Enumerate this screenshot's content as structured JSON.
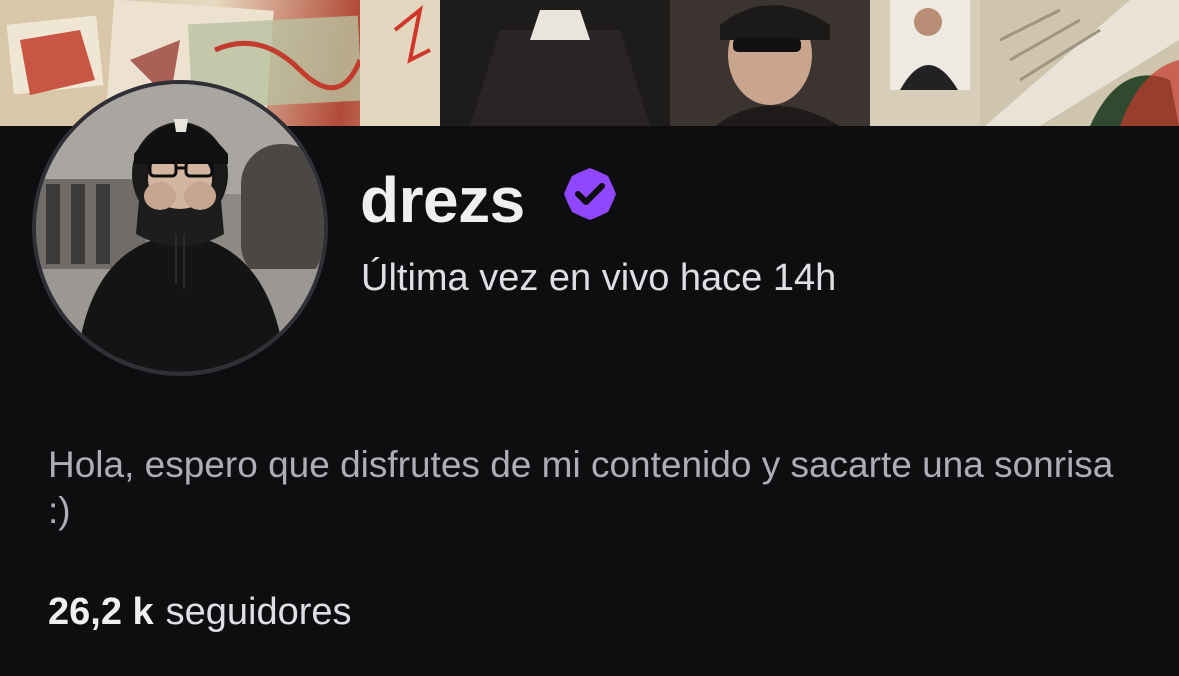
{
  "profile": {
    "channel_name": "drezs",
    "verified": true,
    "last_live": "Última vez en vivo hace 14h",
    "bio": "Hola, espero que disfrutes de mi contenido y sacarte una sonrisa :)",
    "followers_count": "26,2 k",
    "followers_label": "seguidores"
  },
  "colors": {
    "background": "#0e0e10",
    "verified_badge": "#9147ff",
    "primary_text": "#efeff1",
    "secondary_text": "#adadb8",
    "avatar_ring": "#2f2f35"
  },
  "icons": {
    "verified": "verified-badge-icon"
  }
}
